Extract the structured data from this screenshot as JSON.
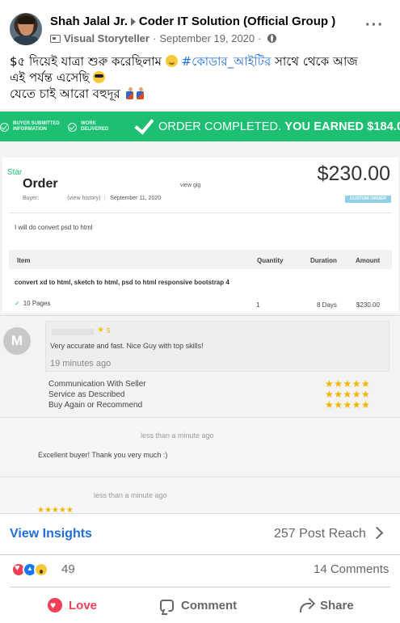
{
  "post": {
    "author": "Shah Jalal Jr.",
    "group": "Coder IT Solution (Official Group )",
    "role": "Visual Storyteller",
    "date": "September 19, 2020",
    "more_icon": "more-options-icon",
    "text": {
      "line1_before": "$৫ দিয়েই যাত্রা শুরু করেছিলাম",
      "hashtag": "#কোডার_আইটির",
      "line1_after": "সাথে থেকে আজ",
      "line2": "এই পর্যন্ত এসেছি",
      "line3": "যেতে চাই আরো বহুদূর"
    }
  },
  "screenshot": {
    "banner": {
      "step1": "BUYER SUBMITTED INFORMATION",
      "step2": "WORK DELIVERED",
      "completed": "ORDER COMPLETED.",
      "earned": "YOU EARNED $184.00"
    },
    "order": {
      "star_tag": "Star",
      "title": "Order",
      "view_gig": "view gig",
      "buyer_label": "Buyer:",
      "view_history": "(view history)",
      "date": "September 11, 2020",
      "price": "$230.00",
      "badge": "CUSTOM ORDER",
      "description": "I will do convert psd to html",
      "columns": [
        "Item",
        "Quantity",
        "Duration",
        "Amount"
      ],
      "item_desc": "convert xd to html, sketch to html, psd to html responsive bootstrap 4",
      "pages": "10 Pages",
      "quantity": "1",
      "duration": "8 Days",
      "amount": "$230.00"
    },
    "review1": {
      "avatar_letter": "M",
      "score": "5",
      "text": "Very accurate and fast. Nice Guy with top skills!",
      "time": "19 minutes ago",
      "criteria": [
        "Communication With Seller",
        "Service as Described",
        "Buy Again or Recommend"
      ],
      "stars": "★★★★★"
    },
    "review2": {
      "time": "less than a minute ago",
      "text": "Excellent buyer! Thank you very much :)"
    },
    "review3": {
      "time": "less than a minute ago",
      "stars": "★★★★★"
    }
  },
  "insights": {
    "label": "View Insights",
    "reach": "257 Post Reach"
  },
  "reactions": {
    "count": "49",
    "comments": "14 Comments"
  },
  "actions": {
    "love": "Love",
    "comment": "Comment",
    "share": "Share"
  },
  "colors": {
    "brand_blue": "#216fdb",
    "fiverr_green": "#1dbf73",
    "love_red": "#f33e58",
    "star_gold": "#f3b400"
  }
}
